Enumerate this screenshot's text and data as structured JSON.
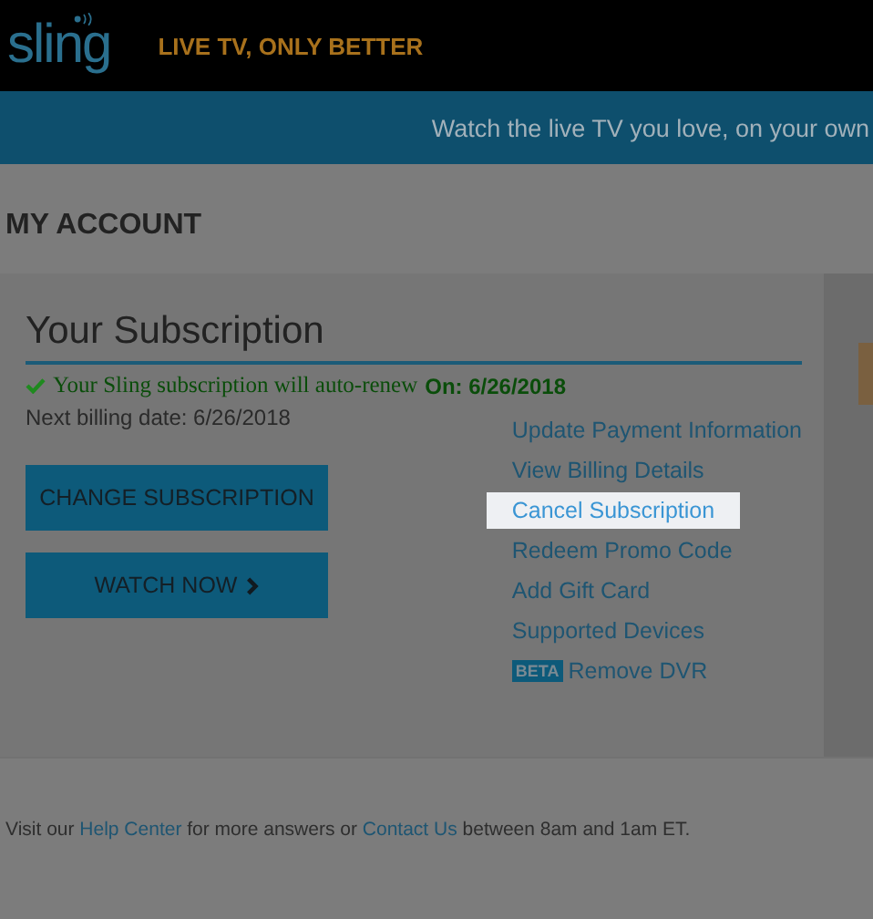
{
  "header": {
    "logo": "sling",
    "tagline": "LIVE TV, ONLY BETTER"
  },
  "banner": {
    "text": "Watch the live TV you love, on your own"
  },
  "page_title": "MY ACCOUNT",
  "subscription": {
    "title": "Your Subscription",
    "renew_note": "Your Sling subscription will auto-renew",
    "renew_date": "On: 6/26/2018",
    "billing": "Next billing date: 6/26/2018",
    "buttons": [
      {
        "label": "CHANGE SUBSCRIPTION",
        "chevron": false
      },
      {
        "label": "WATCH NOW",
        "chevron": true
      }
    ],
    "links": [
      {
        "label": "Update Payment Information",
        "highlighted": false
      },
      {
        "label": "View Billing Details",
        "highlighted": false
      },
      {
        "label": "Cancel Subscription",
        "highlighted": true
      },
      {
        "label": "Redeem Promo Code",
        "highlighted": false
      },
      {
        "label": "Add Gift Card",
        "highlighted": false
      },
      {
        "label": "Supported Devices",
        "highlighted": false
      },
      {
        "label": "Remove DVR",
        "highlighted": false,
        "badge": "BETA"
      }
    ]
  },
  "footer": [
    {
      "kind": "text",
      "text": "Visit our "
    },
    {
      "kind": "link",
      "text": "Help Center"
    },
    {
      "kind": "text",
      "text": " for more answers or "
    },
    {
      "kind": "link",
      "text": "Contact Us"
    },
    {
      "kind": "text",
      "text": "  between 8am and 1am ET."
    }
  ]
}
